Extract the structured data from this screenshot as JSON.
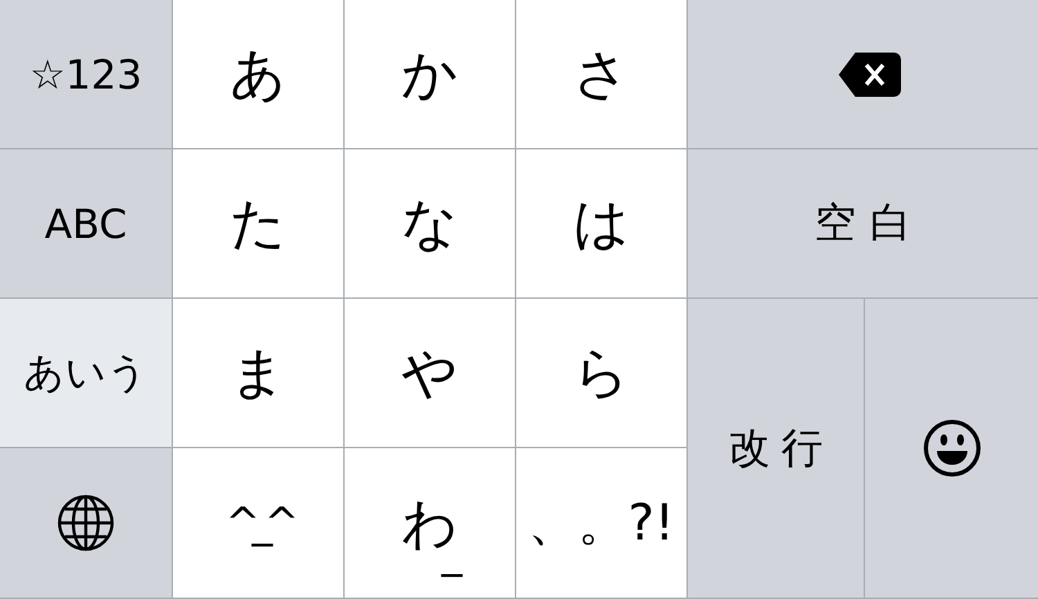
{
  "keyboard": {
    "keys": [
      {
        "kind": "mode",
        "label": "☆123",
        "selected": false
      },
      {
        "kind": "kana",
        "label": "あ"
      },
      {
        "kind": "kana",
        "label": "か"
      },
      {
        "kind": "kana",
        "label": "さ"
      },
      {
        "kind": "delete"
      },
      {
        "kind": "mode",
        "label": "ABC",
        "selected": false
      },
      {
        "kind": "kana",
        "label": "た"
      },
      {
        "kind": "kana",
        "label": "な"
      },
      {
        "kind": "kana",
        "label": "は"
      },
      {
        "kind": "space",
        "label": "空白"
      },
      {
        "kind": "mode",
        "label": "あいう",
        "selected": true
      },
      {
        "kind": "kana",
        "label": "ま"
      },
      {
        "kind": "kana",
        "label": "や"
      },
      {
        "kind": "kana",
        "label": "ら"
      },
      {
        "kind": "return",
        "label": "改行"
      },
      {
        "kind": "emoji"
      },
      {
        "kind": "globe"
      },
      {
        "kind": "face",
        "label": "^_^"
      },
      {
        "kind": "kana",
        "label": "わ",
        "hint": "_"
      },
      {
        "kind": "kana",
        "label": "、。?!"
      }
    ]
  }
}
